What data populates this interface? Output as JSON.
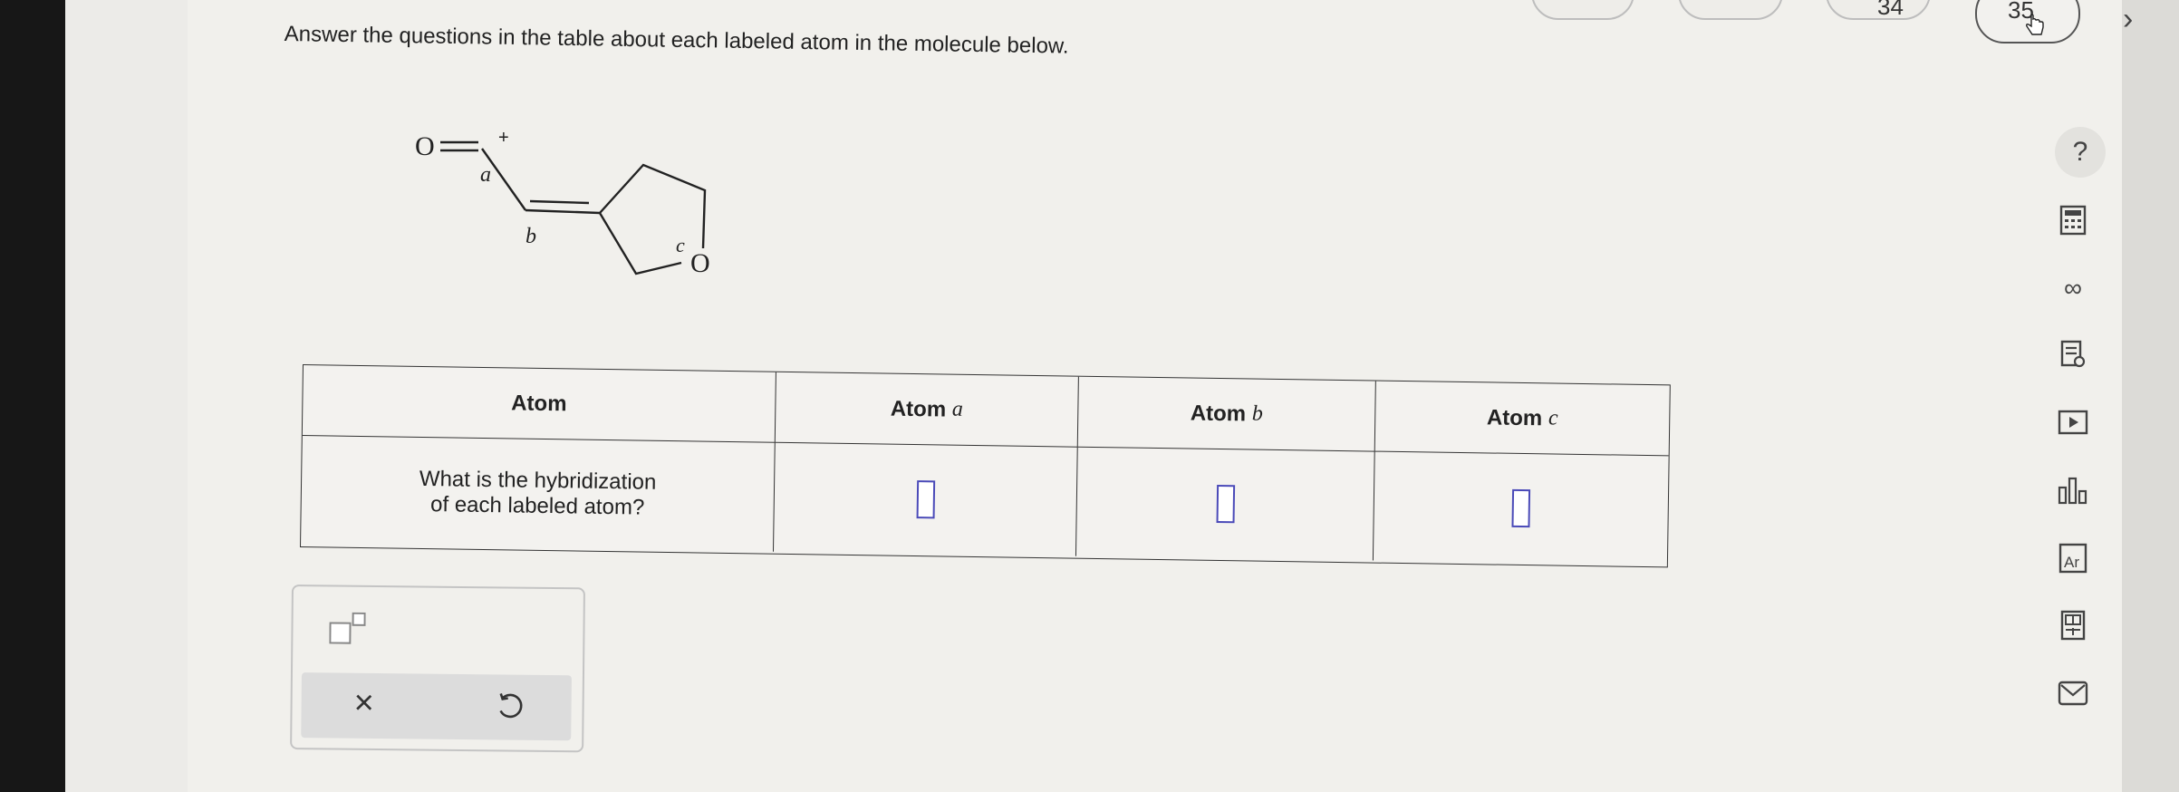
{
  "question": {
    "prompt": "Answer the questions in the table about each labeled atom in the molecule below."
  },
  "navigation": {
    "prev_page": "34",
    "current_page": "35",
    "next_icon": "chevron-right-icon"
  },
  "molecule": {
    "atom_o1": "O",
    "charge": "+",
    "label_a": "a",
    "label_b": "b",
    "label_c": "c",
    "atom_o2": "O"
  },
  "table": {
    "header": {
      "col0": "Atom",
      "col1_prefix": "Atom ",
      "col1_var": "a",
      "col2_prefix": "Atom ",
      "col2_var": "b",
      "col3_prefix": "Atom ",
      "col3_var": "c"
    },
    "row": {
      "question_line1": "What is the hybridization",
      "question_line2": "of each labeled atom?"
    }
  },
  "toolbar": {
    "superscript_icon": "superscript-box-icon",
    "clear_symbol": "×",
    "undo_icon": "undo-icon"
  },
  "side_tools": {
    "help": "?",
    "icons": [
      "calculator-icon",
      "infinity-icon",
      "reference-icon",
      "video-icon",
      "chart-icon",
      "periodic-table-icon",
      "data-icon",
      "mail-icon"
    ]
  }
}
